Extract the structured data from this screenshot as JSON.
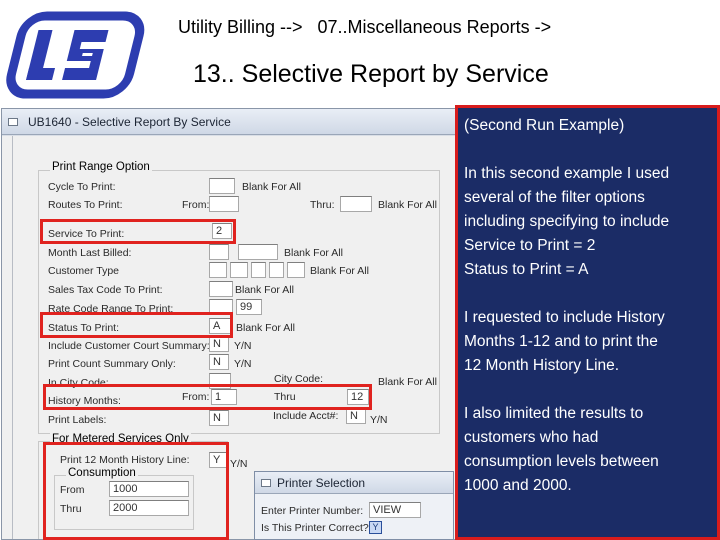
{
  "header": {
    "breadcrumb": "Utility Billing -->   07..Miscellaneous Reports ->",
    "title": "13.. Selective Report by Service",
    "logo_color": "#2d3db0"
  },
  "window": {
    "title": "UB1640 - Selective Report By Service",
    "print_range": {
      "legend": "Print Range Option",
      "cycle_label": "Cycle To Print:",
      "cycle_blank": "Blank For All",
      "routes_label": "Routes To Print:",
      "from_label": "From:",
      "thru_label": "Thru:",
      "routes_blank": "Blank For All",
      "service_label": "Service To Print:",
      "service_value": "2",
      "month_label": "Month Last Billed:",
      "month_blank": "Blank For All",
      "customer_type_label": "Customer Type",
      "customer_type_blank": "Blank For All",
      "sales_tax_label": "Sales Tax Code To Print:",
      "sales_tax_blank": "Blank For All",
      "rate_code_label": "Rate Code Range To Print:",
      "rate_code_value": "99",
      "status_label": "Status To Print:",
      "status_value": "A",
      "status_blank": "Blank For All",
      "court_label": "Include Customer Court Summary:",
      "court_value": "N",
      "court_yn": "Y/N",
      "print_count_label": "Print Count Summary Only:",
      "print_count_value": "N",
      "print_count_yn": "Y/N",
      "in_city_label": "In City Code:",
      "city_code_label": "City Code:",
      "city_code_blank": "Blank For All",
      "history_label": "History Months:",
      "history_from_label": "From:",
      "history_from": "1",
      "history_thru_label": "Thru",
      "history_thru": "12",
      "print_labels_label": "Print Labels:",
      "print_labels_value": "N",
      "include_acct_label": "Include Acct#:",
      "include_acct_value": "N",
      "include_acct_yn": "Y/N"
    },
    "metered": {
      "legend": "For Metered Services Only",
      "history_line_label": "Print 12 Month History Line:",
      "history_line_value": "Y",
      "history_line_yn": "Y/N",
      "consumption_legend": "Consumption",
      "from_label": "From",
      "from_value": "1000",
      "thru_label": "Thru",
      "thru_value": "2000"
    }
  },
  "printer_dialog": {
    "title": "Printer Selection",
    "printer_label": "Enter Printer Number:",
    "printer_value": "VIEW",
    "correct_label": "Is This Printer Correct?",
    "correct_value": "Y"
  },
  "explanation": {
    "heading": "(Second Run Example)",
    "line1": "In this second example I used",
    "line2": "several of the filter options",
    "line3": "including specifying to include",
    "line4": "Service to Print = 2",
    "line5": "Status to Print = A",
    "line6": "I requested to include History",
    "line7": "Months 1-12 and to print the",
    "line8": "12 Month History Line.",
    "line9": "I also limited the results to",
    "line10": "customers who had",
    "line11": "consumption levels between",
    "line12": "1000 and 2000."
  },
  "colors": {
    "panel_bg": "#1b2c66",
    "highlight": "#e0231f"
  }
}
